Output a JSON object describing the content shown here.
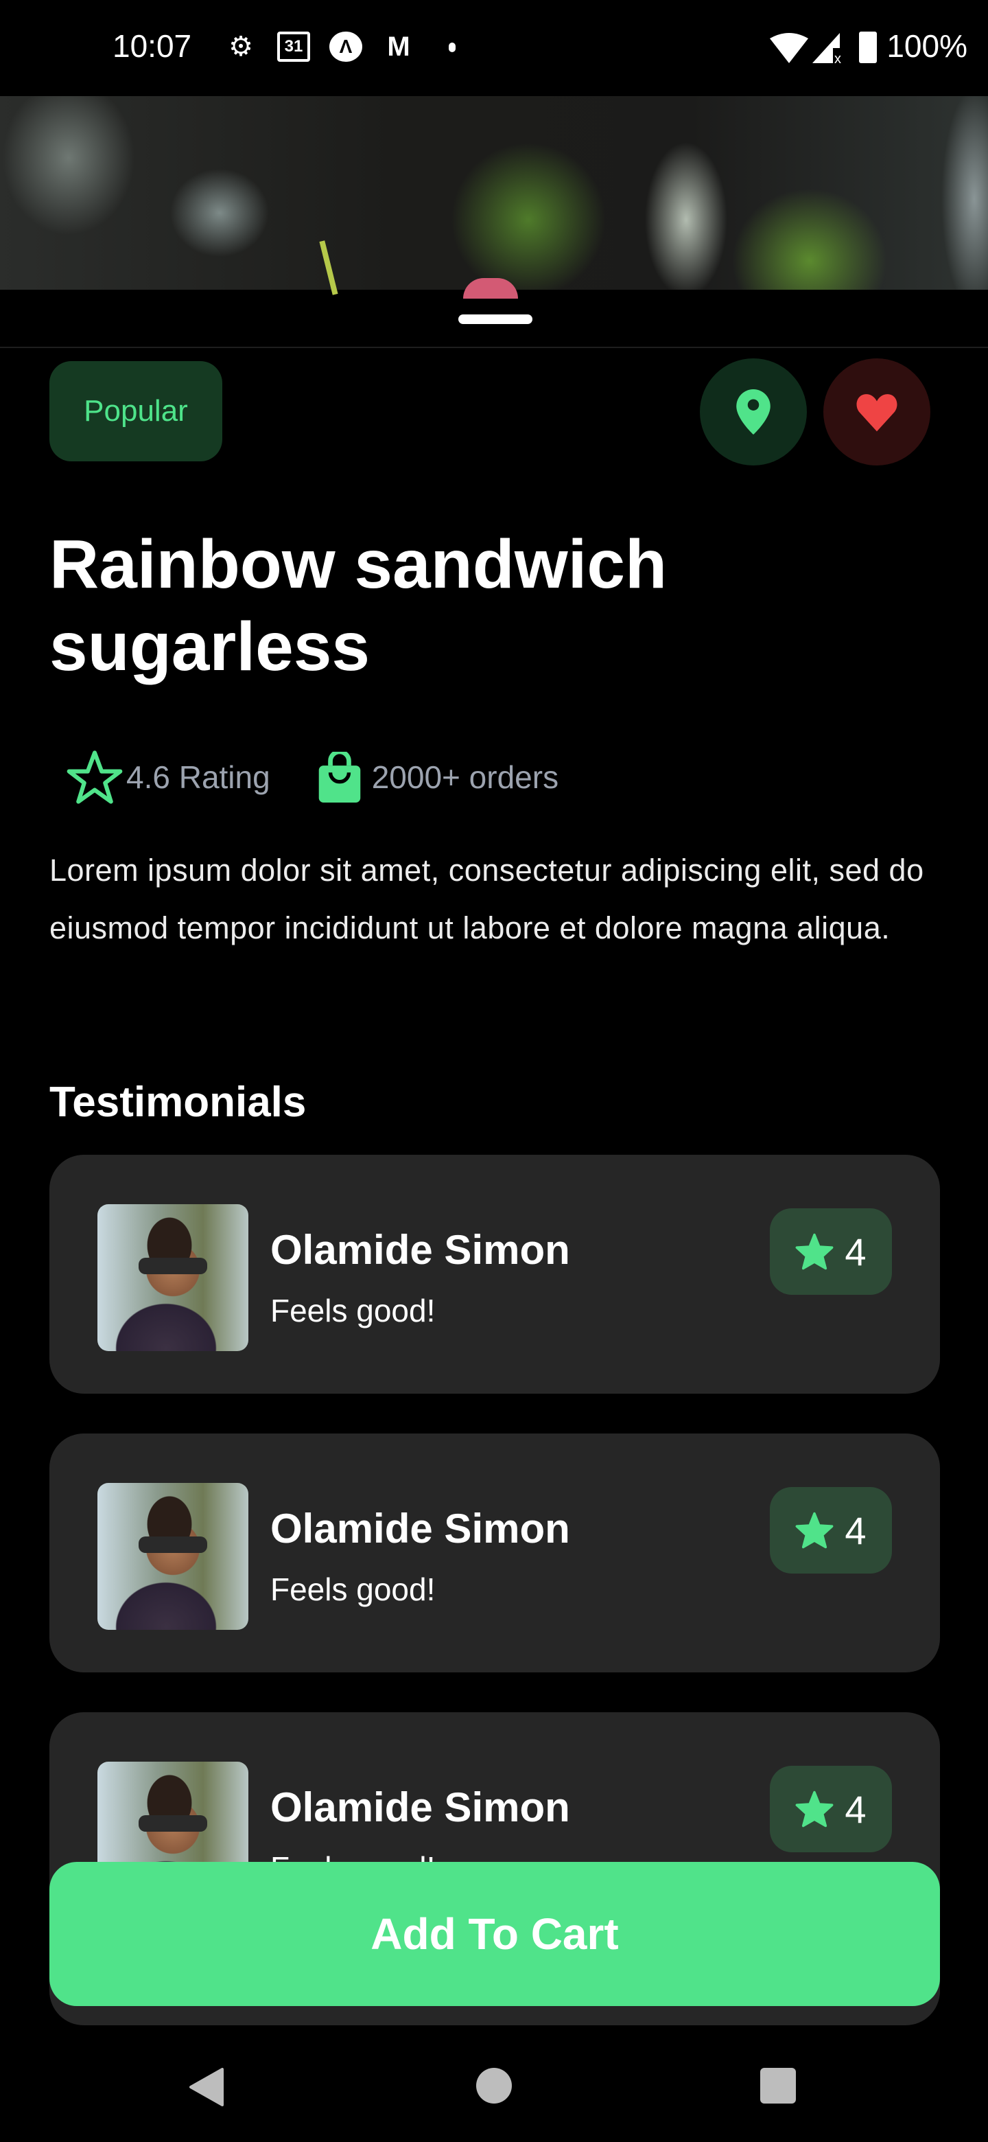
{
  "status_bar": {
    "time": "10:07",
    "battery": "100%",
    "icons": [
      "gear-icon",
      "calendar-icon",
      "app-icon",
      "gmail-icon",
      "dot-icon",
      "wifi-icon",
      "signal-icon",
      "battery-icon"
    ],
    "calendar_day": "31"
  },
  "product": {
    "badge": "Popular",
    "title": "Rainbow sandwich sugarless",
    "rating": "4.6 Rating",
    "orders": "2000+ orders",
    "description": "Lorem ipsum dolor sit amet, consectetur adipiscing elit, sed do eiusmod tempor incididunt ut labore et dolore magna aliqua."
  },
  "testimonials": {
    "heading": "Testimonials",
    "items": [
      {
        "name": "Olamide Simon",
        "text": "Feels good!",
        "rating": "4"
      },
      {
        "name": "Olamide Simon",
        "text": "Feels good!",
        "rating": "4"
      },
      {
        "name": "Olamide Simon",
        "text": "Feels good!",
        "rating": "4"
      }
    ]
  },
  "cart_button": "Add To Cart",
  "colors": {
    "accent": "#50e38a",
    "heart": "#ef4444",
    "card": "#262626"
  }
}
